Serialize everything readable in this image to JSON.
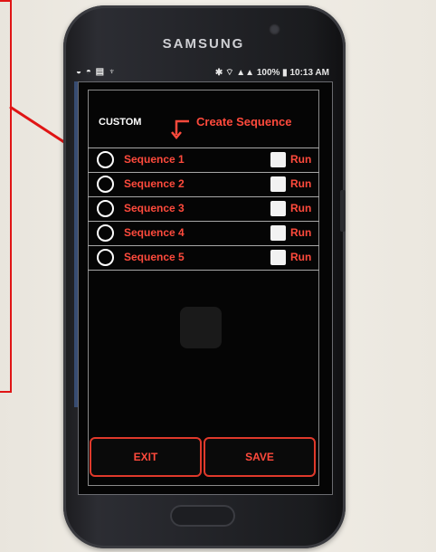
{
  "device": {
    "brand": "SAMSUNG",
    "status_left": "◒ ◓ ▤ ♆",
    "status_right": "✱ ⌔ ▲▲ 100% ▮ 10:13 AM"
  },
  "header": {
    "mode_label": "CUSTOM",
    "create_label": "Create Sequence"
  },
  "sequences": [
    {
      "label": "Sequence 1",
      "run_label": "Run"
    },
    {
      "label": "Sequence 2",
      "run_label": "Run"
    },
    {
      "label": "Sequence 3",
      "run_label": "Run"
    },
    {
      "label": "Sequence 4",
      "run_label": "Run"
    },
    {
      "label": "Sequence 5",
      "run_label": "Run"
    }
  ],
  "buttons": {
    "exit_label": "EXIT",
    "save_label": "SAVE"
  },
  "colors": {
    "accent": "#ff4a3c",
    "annotation": "#e01515",
    "screen_bg": "#050505"
  }
}
